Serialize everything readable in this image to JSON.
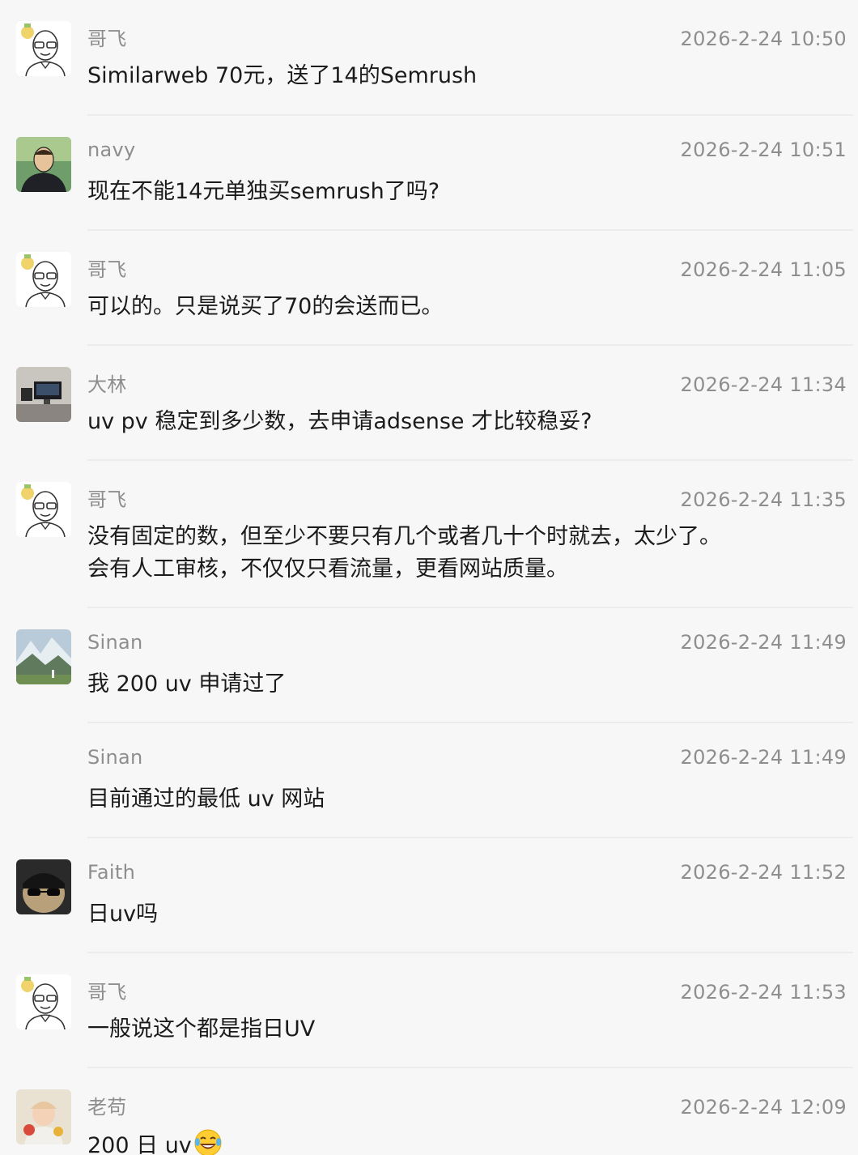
{
  "messages": [
    {
      "name": "哥飞",
      "time": "2026-2-24 10:50",
      "lines": [
        "Similarweb 70元，送了14的Semrush"
      ],
      "avatar": "gefei-icon"
    },
    {
      "name": "navy",
      "time": "2026-2-24 10:51",
      "lines": [
        "现在不能14元单独买semrush了吗?"
      ],
      "avatar": "navy-avatar-icon"
    },
    {
      "name": "哥飞",
      "time": "2026-2-24 11:05",
      "lines": [
        "可以的。只是说买了70的会送而已。"
      ],
      "avatar": "gefei-icon"
    },
    {
      "name": "大林",
      "time": "2026-2-24 11:34",
      "lines": [
        "uv pv  稳定到多少数，去申请adsense 才比较稳妥?"
      ],
      "avatar": "desk-photo-icon"
    },
    {
      "name": "哥飞",
      "time": "2026-2-24 11:35",
      "lines": [
        "没有固定的数，但至少不要只有几个或者几十个时就去，太少了。",
        "会有人工审核，不仅仅只看流量，更看网站质量。"
      ],
      "avatar": "gefei-icon"
    },
    {
      "name": "Sinan",
      "time": "2026-2-24 11:49",
      "lines": [
        "我 200  uv 申请过了"
      ],
      "avatar": "mountain-photo-icon"
    },
    {
      "name": "Sinan",
      "time": "2026-2-24 11:49",
      "lines": [
        "目前通过的最低 uv 网站"
      ],
      "avatar": ""
    },
    {
      "name": "Faith",
      "time": "2026-2-24 11:52",
      "lines": [
        "日uv吗"
      ],
      "avatar": "sunglasses-avatar-icon"
    },
    {
      "name": "哥飞",
      "time": "2026-2-24 11:53",
      "lines": [
        "一般说这个都是指日UV"
      ],
      "avatar": "gefei-icon"
    },
    {
      "name": "老苟",
      "time": "2026-2-24 12:09",
      "lines": [
        "200 日 uv"
      ],
      "avatar": "child-photo-icon",
      "emoji": "laughing-tears-emoji"
    }
  ]
}
